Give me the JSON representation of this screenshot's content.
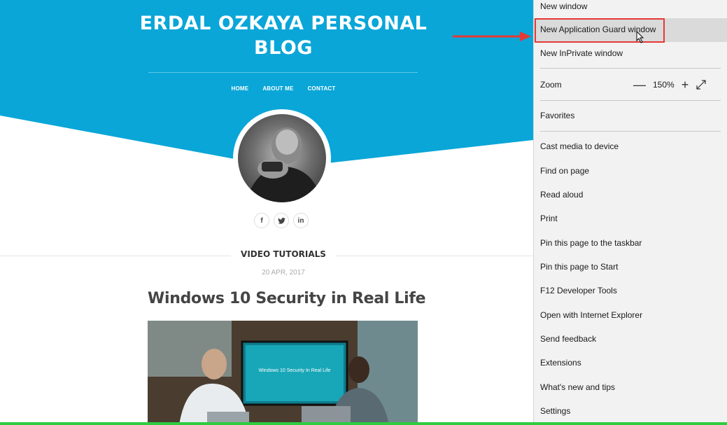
{
  "blog": {
    "title": "ERDAL OZKAYA PERSONAL BLOG",
    "nav": [
      "HOME",
      "ABOUT ME",
      "CONTACT"
    ],
    "social_icons": [
      "f",
      "t",
      "in"
    ],
    "section_title": "VIDEO TUTORIALS",
    "post_date": "20 APR, 2017",
    "post_title": "Windows 10 Security in Real Life",
    "video_screen_text": "Windows 10 Security In Real Life"
  },
  "menu": {
    "items": {
      "new_window": "New window",
      "new_app_guard": "New Application Guard window",
      "new_inprivate": "New InPrivate window",
      "zoom": "Zoom",
      "zoom_level": "150%",
      "favorites": "Favorites",
      "cast": "Cast media to device",
      "find": "Find on page",
      "read_aloud": "Read aloud",
      "print": "Print",
      "pin_taskbar": "Pin this page to the taskbar",
      "pin_start": "Pin this page to Start",
      "devtools": "F12 Developer Tools",
      "open_ie": "Open with Internet Explorer",
      "feedback": "Send feedback",
      "extensions": "Extensions",
      "whats_new": "What's new and tips",
      "settings": "Settings"
    },
    "zoom_minus": "—",
    "zoom_plus": "+"
  },
  "colors": {
    "hero": "#0aa6d8",
    "highlight_border": "#e53935",
    "accent_bar": "#2ecc40"
  }
}
